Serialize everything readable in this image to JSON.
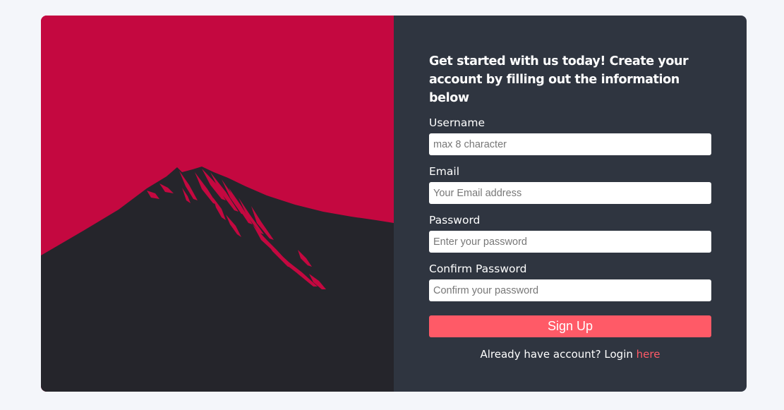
{
  "colors": {
    "page_bg": "#f4f6fa",
    "hero_sky": "#c40840",
    "mountain": "#25252b",
    "panel_bg": "#2f3540",
    "accent": "#ff5a67"
  },
  "hero": {
    "image": "mountain-illustration"
  },
  "form": {
    "heading": "Get started with us today! Create your account by filling out the information below",
    "fields": [
      {
        "label": "Username",
        "placeholder": "max 8 character",
        "value": ""
      },
      {
        "label": "Email",
        "placeholder": "Your Email address",
        "value": ""
      },
      {
        "label": "Password",
        "placeholder": "Enter your password",
        "value": ""
      },
      {
        "label": "Confirm Password",
        "placeholder": "Confirm your password",
        "value": ""
      }
    ],
    "submit_label": "Sign Up",
    "login_prompt": "Already have account? Login",
    "login_link": "here"
  }
}
